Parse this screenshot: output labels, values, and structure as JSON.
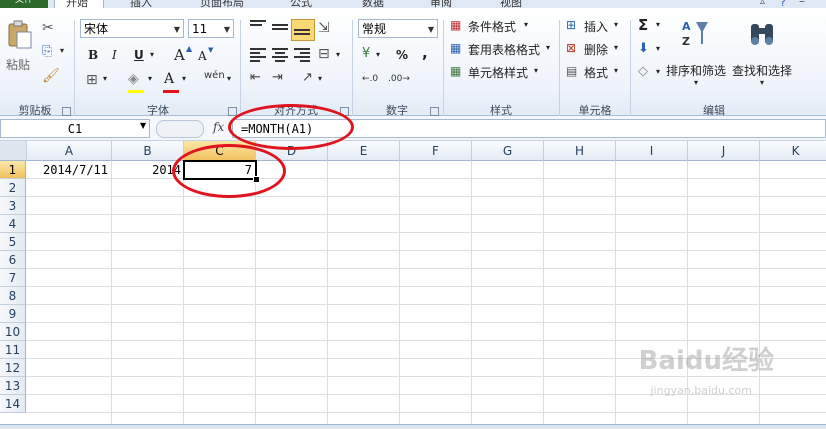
{
  "tabs": {
    "file": "文件",
    "items": [
      "开始",
      "插入",
      "页面布局",
      "公式",
      "数据",
      "审阅",
      "视图"
    ]
  },
  "clipboard": {
    "paste": "粘贴",
    "label": "剪贴板"
  },
  "font": {
    "name": "宋体",
    "size": "11",
    "bold": "B",
    "italic": "I",
    "underline": "U",
    "grow": "A",
    "shrink": "A",
    "color_letter": "A",
    "label": "字体"
  },
  "alignment": {
    "label": "对齐方式"
  },
  "number": {
    "format": "常规",
    "percent": "%",
    "comma": ",",
    "label": "数字"
  },
  "styles": {
    "conditional": "条件格式",
    "table": "套用表格格式",
    "cell": "单元格样式",
    "label": "样式"
  },
  "cells": {
    "insert": "插入",
    "delete": "删除",
    "format": "格式",
    "label": "单元格"
  },
  "editing": {
    "sigma": "Σ",
    "sort": "排序和筛选",
    "find": "查找和选择",
    "label": "编辑"
  },
  "formula_bar": {
    "name_box": "C1",
    "fx": "fx",
    "formula": "=MONTH(A1)"
  },
  "grid": {
    "columns": [
      "A",
      "B",
      "C",
      "D",
      "E",
      "F",
      "G",
      "H",
      "I",
      "J",
      "K"
    ],
    "rows": [
      "1",
      "2",
      "3",
      "4",
      "5",
      "6",
      "7",
      "8",
      "9",
      "10",
      "11",
      "12",
      "13",
      "14"
    ],
    "cells": {
      "A1": "2014/7/11",
      "B1": "2014",
      "C1": "7"
    }
  },
  "watermark": {
    "brand": "Baidu经验",
    "url": "jingyan.baidu.com"
  },
  "colors": {
    "accent": "#e0141e",
    "selected_header": "#f1c15f",
    "file_tab": "#2c6a2c"
  }
}
